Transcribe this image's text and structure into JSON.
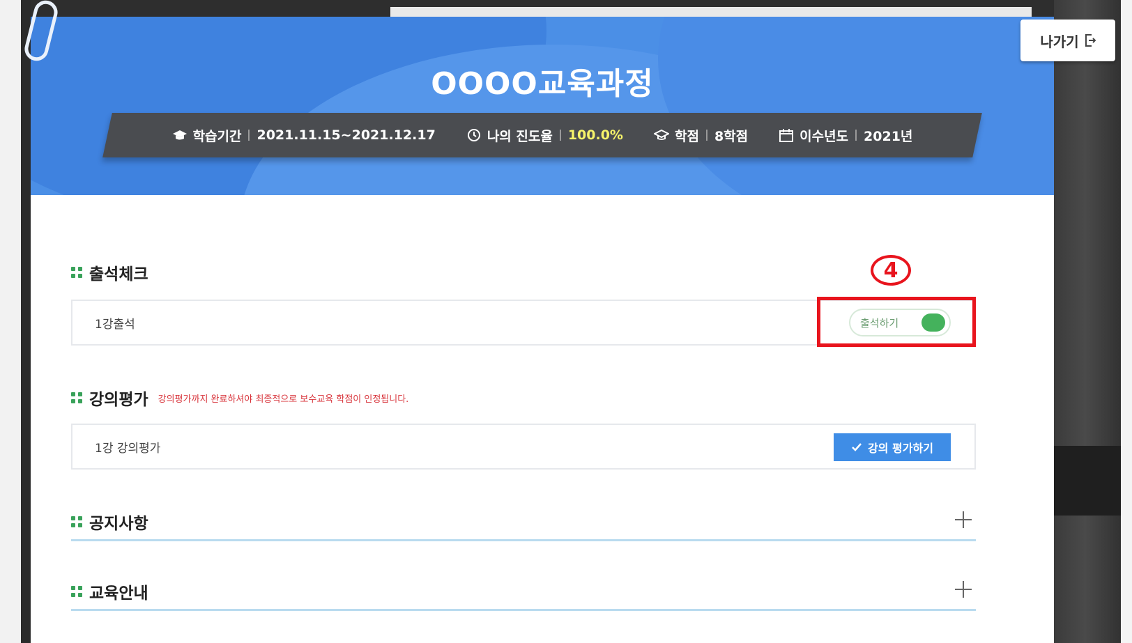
{
  "header": {
    "title": "OOOO교육과정",
    "exit_label": "나가기",
    "info": [
      {
        "icon": "graduation-cap-icon",
        "label": "학습기간",
        "value": "2021.11.15~2021.12.17",
        "accent": false
      },
      {
        "icon": "clock-icon",
        "label": "나의 진도율",
        "value": "100.0%",
        "accent": true
      },
      {
        "icon": "mortarboard-icon",
        "label": "학점",
        "value": "8학점",
        "accent": false
      },
      {
        "icon": "calendar-icon",
        "label": "이수년도",
        "value": "2021년",
        "accent": false
      }
    ]
  },
  "attendance": {
    "title": "출석체크",
    "row_label": "1강출석",
    "button_label": "출석하기",
    "annotation_number": "4"
  },
  "evaluation": {
    "title": "강의평가",
    "note": "강의평가까지 완료하셔야 최종적으로 보수교육 학점이 인정됩니다.",
    "row_label": "1강 강의평가",
    "button_label": "강의 평가하기"
  },
  "notice": {
    "title": "공지사항"
  },
  "guide": {
    "title": "교육안내"
  },
  "colors": {
    "header_blue": "#4b8fe6",
    "accent_yellow": "#f6f36a",
    "green": "#39a25a",
    "highlight_red": "#e8141d",
    "button_blue": "#3f8de6"
  }
}
